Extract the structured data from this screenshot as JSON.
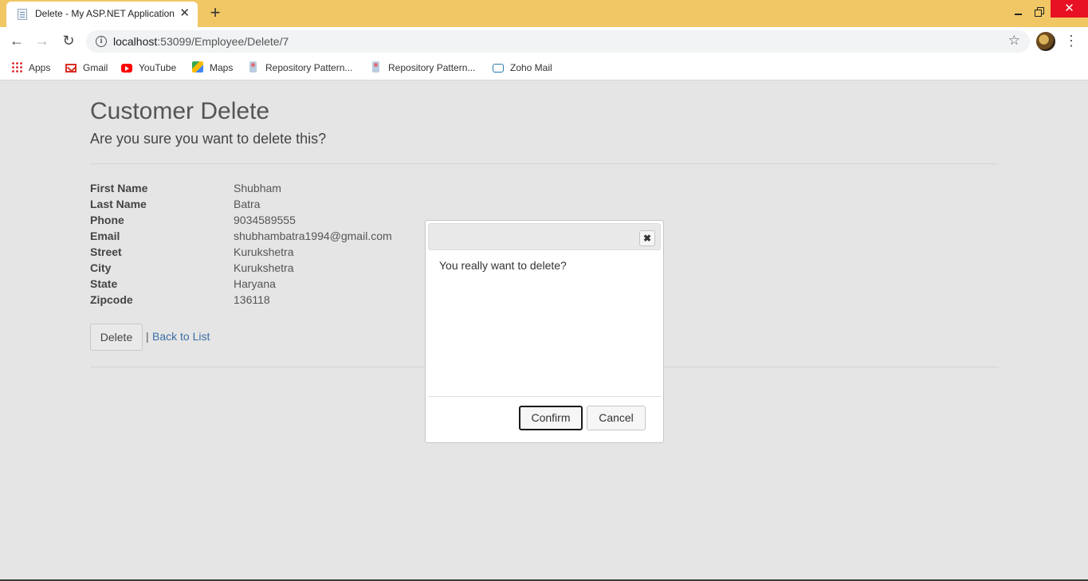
{
  "browser": {
    "tab_title": "Delete - My ASP.NET Application",
    "new_tab": "+",
    "url_host": "localhost",
    "url_path": ":53099/Employee/Delete/7",
    "bookmarks": [
      {
        "label": "Apps",
        "icon": "apps-grid-icon"
      },
      {
        "label": "Gmail",
        "icon": "gmail-icon"
      },
      {
        "label": "YouTube",
        "icon": "youtube-icon"
      },
      {
        "label": "Maps",
        "icon": "maps-icon"
      },
      {
        "label": "Repository Pattern...",
        "icon": "page-favicon-icon"
      },
      {
        "label": "Repository Pattern...",
        "icon": "page-favicon-icon"
      },
      {
        "label": "Zoho Mail",
        "icon": "zoho-mail-icon"
      }
    ]
  },
  "page": {
    "title": "Customer Delete",
    "subtitle": "Are you sure you want to delete this?",
    "fields": [
      {
        "label": "First Name",
        "value": "Shubham"
      },
      {
        "label": "Last Name",
        "value": "Batra"
      },
      {
        "label": "Phone",
        "value": "9034589555"
      },
      {
        "label": "Email",
        "value": "shubhambatra1994@gmail.com"
      },
      {
        "label": "Street",
        "value": "Kurukshetra"
      },
      {
        "label": "City",
        "value": "Kurukshetra"
      },
      {
        "label": "State",
        "value": "Haryana"
      },
      {
        "label": "Zipcode",
        "value": "136118"
      }
    ],
    "delete_label": "Delete",
    "separator": "|",
    "back_link": "Back to List"
  },
  "dialog": {
    "message": "You really want to delete?",
    "confirm_label": "Confirm",
    "cancel_label": "Cancel"
  },
  "colors": {
    "titlebar": "#f1c765",
    "page_background": "#e5e5e5",
    "link": "#3b6ea5",
    "close_button": "#e81123"
  }
}
